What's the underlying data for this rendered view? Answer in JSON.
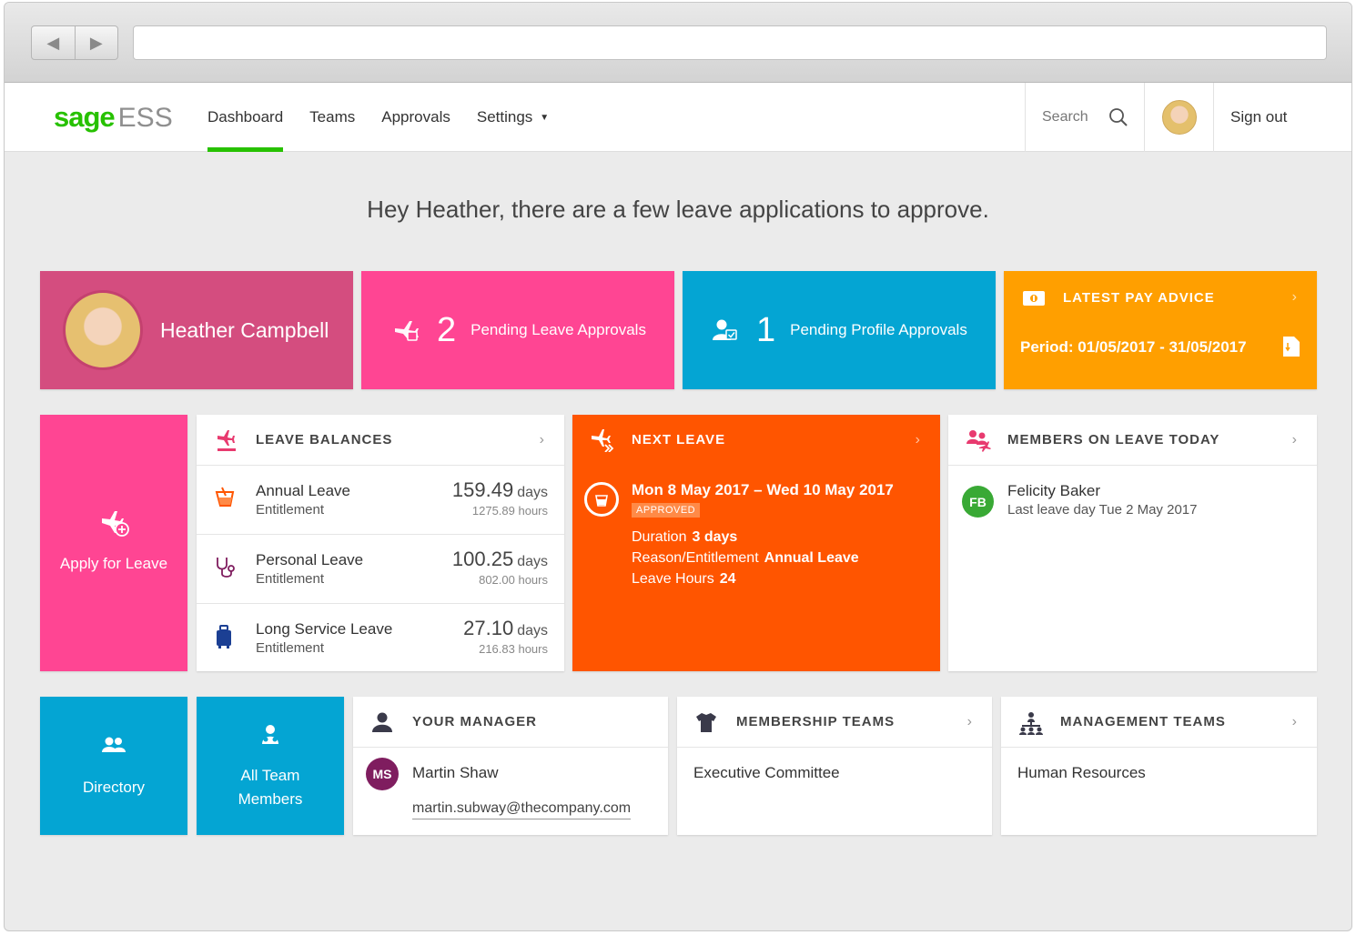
{
  "browser": {
    "back_icon": "back-arrow-icon",
    "forward_icon": "forward-arrow-icon",
    "url": ""
  },
  "nav": {
    "logo_sage": "sage",
    "logo_product": "ESS",
    "items": [
      {
        "label": "Dashboard",
        "active": true
      },
      {
        "label": "Teams",
        "active": false
      },
      {
        "label": "Approvals",
        "active": false
      },
      {
        "label": "Settings",
        "active": false
      }
    ],
    "search_label": "Search",
    "sign_out": "Sign out",
    "accent_color": "#27c100"
  },
  "greeting": "Hey Heather, there are a few leave applications to approve.",
  "profile": {
    "name": "Heather Campbell",
    "color": "#d44d7f"
  },
  "pending_leave": {
    "count": "2",
    "label": "Pending Leave Approvals",
    "color": "#ff4593"
  },
  "pending_profile": {
    "count": "1",
    "label": "Pending Profile Approvals",
    "color": "#04a5d3"
  },
  "pay_advice": {
    "title": "LATEST PAY ADVICE",
    "period": "Period: 01/05/2017 - 31/05/2017",
    "color": "#ff9f00"
  },
  "apply_leave": {
    "label": "Apply for Leave"
  },
  "leave_balances": {
    "title": "LEAVE BALANCES",
    "rows": [
      {
        "name": "Annual Leave",
        "sub": "Entitlement",
        "days": "159.49",
        "days_unit": "days",
        "hours": "1275.89 hours",
        "icon": "cocktail-icon"
      },
      {
        "name": "Personal Leave",
        "sub": "Entitlement",
        "days": "100.25",
        "days_unit": "days",
        "hours": "802.00 hours",
        "icon": "stethoscope-icon"
      },
      {
        "name": "Long Service Leave",
        "sub": "Entitlement",
        "days": "27.10",
        "days_unit": "days",
        "hours": "216.83 hours",
        "icon": "luggage-icon"
      }
    ]
  },
  "next_leave": {
    "title": "NEXT LEAVE",
    "dates": "Mon 8 May 2017 – Wed 10 May 2017",
    "status": "APPROVED",
    "duration_label": "Duration",
    "duration_value": "3 days",
    "reason_label": "Reason/Entitlement",
    "reason_value": "Annual Leave",
    "hours_label": "Leave Hours",
    "hours_value": "24",
    "color": "#ff5500"
  },
  "members_on_leave": {
    "title": "MEMBERS ON LEAVE TODAY",
    "initials": "FB",
    "name": "Felicity Baker",
    "detail": "Last leave day Tue 2 May 2017"
  },
  "directory": {
    "label": "Directory"
  },
  "all_team": {
    "label_line1": "All Team",
    "label_line2": "Members"
  },
  "your_manager": {
    "title": "YOUR MANAGER",
    "initials": "MS",
    "name": "Martin Shaw",
    "email": "martin.subway@thecompany.com"
  },
  "membership_teams": {
    "title": "MEMBERSHIP TEAMS",
    "team": "Executive Committee"
  },
  "management_teams": {
    "title": "MANAGEMENT TEAMS",
    "team": "Human Resources"
  }
}
